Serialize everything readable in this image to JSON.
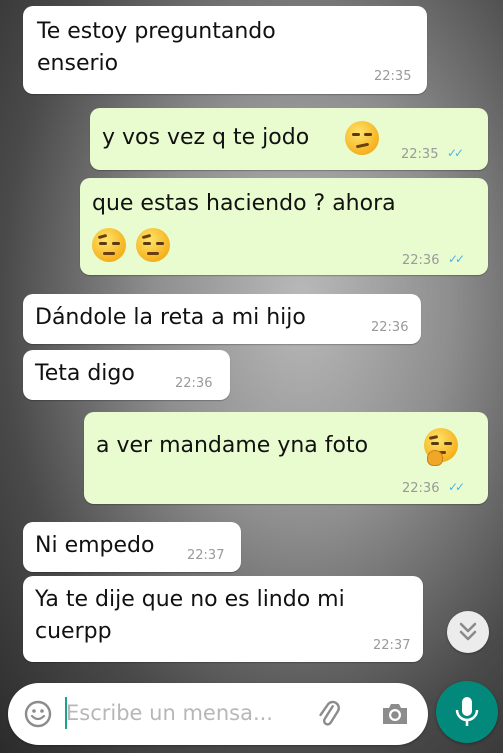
{
  "messages": [
    {
      "dir": "in",
      "lines": [
        "Te estoy preguntando",
        "enserio"
      ],
      "time": "22:35"
    },
    {
      "dir": "out",
      "lines": [
        "y vos vez q te jodo"
      ],
      "time": "22:35",
      "emoji": [
        "smirking-face"
      ]
    },
    {
      "dir": "out",
      "lines": [
        "que estas haciendo ? ahora"
      ],
      "time": "22:36",
      "emoji": [
        "face-with-raised-eyebrow",
        "face-with-raised-eyebrow"
      ]
    },
    {
      "dir": "in",
      "lines": [
        "Dándole la reta a mi hijo"
      ],
      "time": "22:36"
    },
    {
      "dir": "in",
      "lines": [
        "Teta digo"
      ],
      "time": "22:36"
    },
    {
      "dir": "out",
      "lines": [
        "a ver mandame yna foto"
      ],
      "time": "22:36",
      "emoji": [
        "thinking-face"
      ]
    },
    {
      "dir": "in",
      "lines": [
        "Ni empedo"
      ],
      "time": "22:37"
    },
    {
      "dir": "in",
      "lines": [
        "Ya te dije que no es lindo mi",
        "cuerpp"
      ],
      "time": "22:37"
    }
  ],
  "composer": {
    "placeholder": "Escribe un mensa...",
    "icons": [
      "emoji-icon",
      "attach-icon",
      "camera-icon"
    ]
  },
  "mic_icon": "mic-icon",
  "scroll_icon": "double-chevron-down-icon",
  "colors": {
    "incoming": "#ffffff",
    "outgoing": "#e8fccf",
    "accent": "#03897b",
    "read_ticks": "#4fb3ea"
  }
}
